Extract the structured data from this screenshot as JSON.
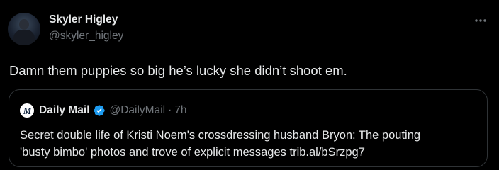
{
  "tweet": {
    "author": {
      "display_name": "Skyler Higley",
      "handle": "@skyler_higley"
    },
    "text": "Damn them puppies so big he’s lucky she didn’t shoot em.",
    "more_icon": "more-horizontal-icon"
  },
  "quote": {
    "author": {
      "logo_glyph": "M",
      "display_name": "Daily Mail",
      "verified_icon": "verified-badge-icon",
      "verified_color": "#1d9bf0",
      "handle": "@DailyMail",
      "separator": "·",
      "time": "7h"
    },
    "text_lines": [
      "Secret double life of Kristi Noem's crossdressing husband Bryon: The pouting",
      "'busty bimbo' photos and trove of explicit messages trib.al/bSrzpg7"
    ]
  },
  "colors": {
    "background": "#000000",
    "primary_text": "#e7e9ea",
    "secondary_text": "#71767b",
    "border": "#2f3336"
  }
}
